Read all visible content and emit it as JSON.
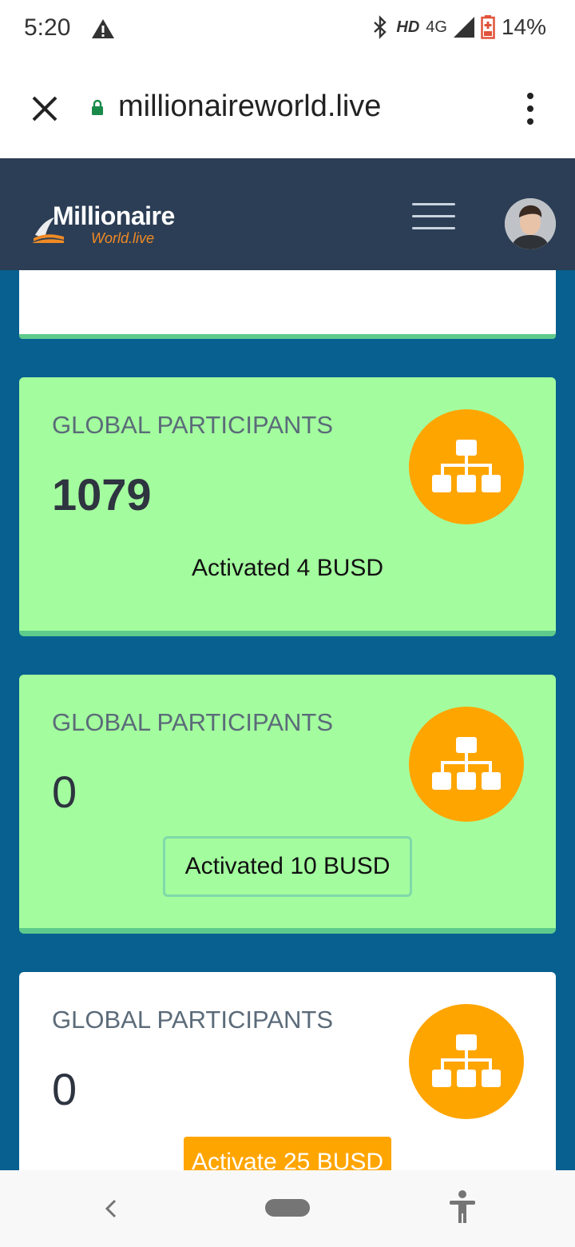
{
  "status_bar": {
    "time": "5:20",
    "hd": "HD",
    "network": "4G",
    "battery": "14%"
  },
  "browser": {
    "url": "millionaireworld.live"
  },
  "site": {
    "logo_main": "Millionaire",
    "logo_sub": "World.live"
  },
  "cards": [
    {
      "title": "GLOBAL PARTICIPANTS",
      "value": "1079",
      "status": "Activated 4 BUSD"
    },
    {
      "title": "GLOBAL PARTICIPANTS",
      "value": "0",
      "button": "Activated 10 BUSD"
    },
    {
      "title": "GLOBAL PARTICIPANTS",
      "value": "0",
      "button": "Activate 25 BUSD"
    }
  ],
  "colors": {
    "header_bg": "#2c3e55",
    "content_bg": "#07608f",
    "card_green": "#a3fd9e",
    "accent_orange": "#ffa500",
    "card_border_green": "#5ecb8c"
  },
  "icons": [
    "warning-icon",
    "bluetooth-icon",
    "signal-icon",
    "battery-icon",
    "close-icon",
    "lock-icon",
    "more-vert-icon",
    "hamburger-icon",
    "avatar",
    "hierarchy-icon",
    "back-icon",
    "home-pill",
    "accessibility-icon"
  ]
}
